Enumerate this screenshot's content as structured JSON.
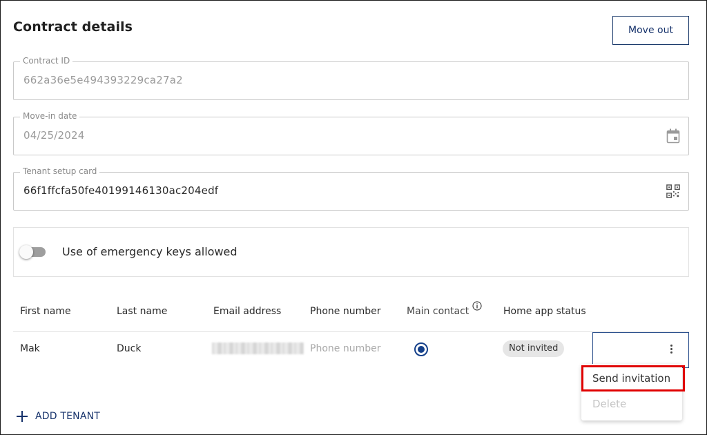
{
  "page": {
    "title": "Contract details",
    "move_out_label": "Move out"
  },
  "fields": {
    "contract_id": {
      "label": "Contract ID",
      "value": "662a36e5e494393229ca27a2"
    },
    "move_in_date": {
      "label": "Move-in date",
      "value": "04/25/2024",
      "icon": "calendar-icon"
    },
    "tenant_setup_card": {
      "label": "Tenant setup card",
      "value": "66f1ffcfa50fe40199146130ac204edf",
      "icon": "qr-code-icon"
    }
  },
  "emergency_keys": {
    "label": "Use of emergency keys allowed",
    "enabled": false
  },
  "table": {
    "headers": [
      "First name",
      "Last name",
      "Email address",
      "Phone number",
      "Main contact",
      "Home app status"
    ],
    "rows": [
      {
        "first_name": "Mak",
        "last_name": "Duck",
        "email": "",
        "phone_placeholder": "Phone number",
        "main_contact": true,
        "home_app_status": "Not invited"
      }
    ]
  },
  "row_menu": {
    "items": [
      "Send invitation",
      "Delete"
    ]
  },
  "add_tenant_label": "ADD TENANT",
  "colors": {
    "accent": "#16326b",
    "highlight": "#e00000",
    "radio": "#15408a"
  }
}
